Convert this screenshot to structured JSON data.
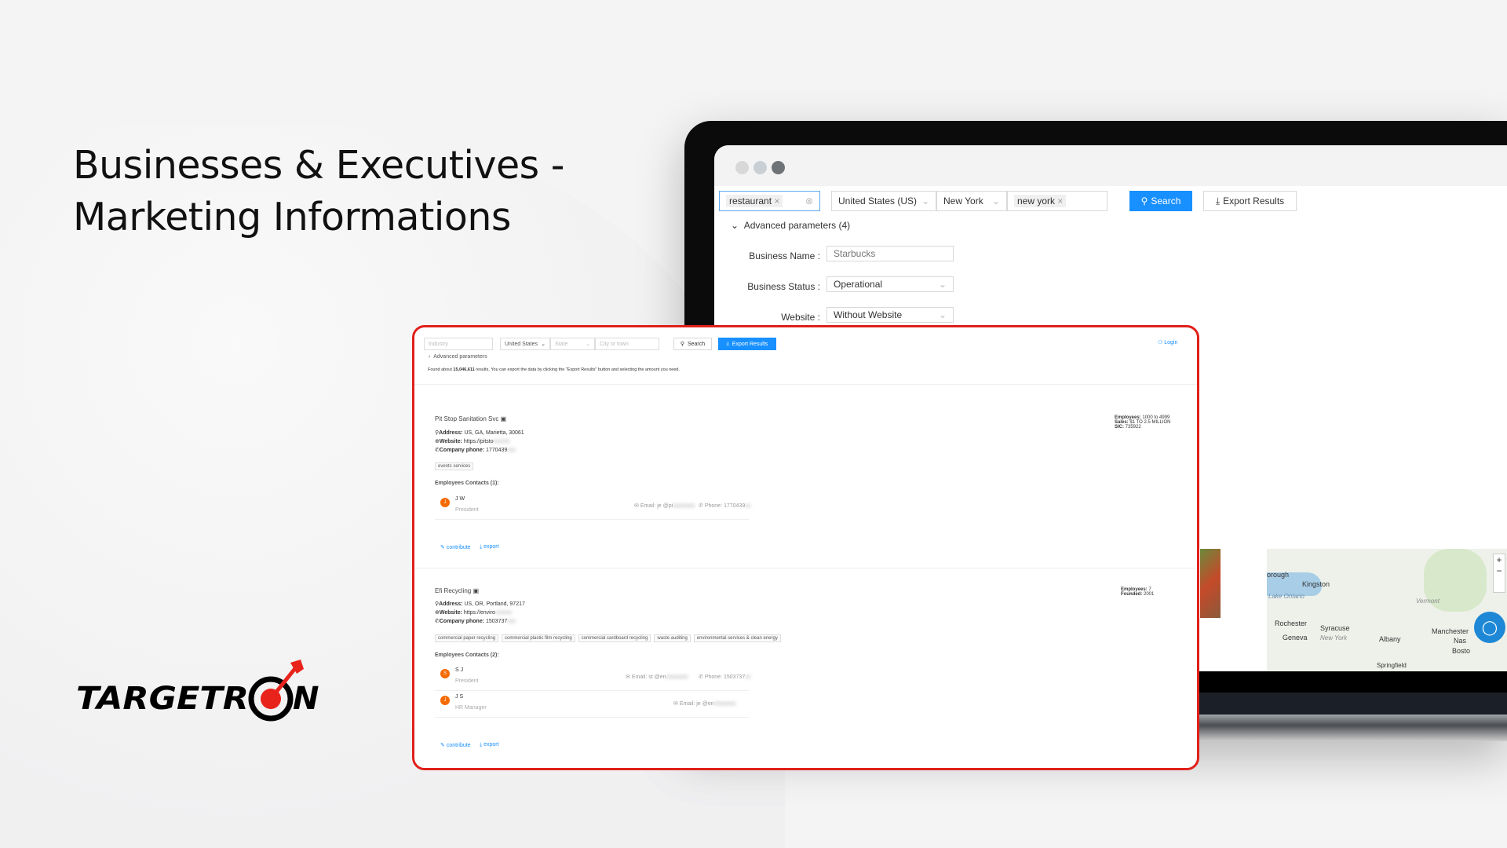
{
  "headline": {
    "line1": "Businesses & Executives -",
    "line2": "Marketing Informations"
  },
  "brand": {
    "logo_text": "TARGETRON",
    "accent": "#e8231c"
  },
  "laptop_app": {
    "keyword_tag": "restaurant",
    "country": "United States (US)",
    "state": "New York",
    "city_tag": "new york",
    "search_label": "Search",
    "export_label": "Export Results",
    "advanced_label": "Advanced parameters (4)",
    "fields": [
      {
        "label": "Business Name :",
        "placeholder": "Starbucks"
      },
      {
        "label": "Business Status :",
        "value": "Operational"
      },
      {
        "label": "Website :",
        "value": "Without Website"
      }
    ],
    "map_labels": [
      "orough",
      "Kingston",
      "Lake Ontario",
      "Vermont",
      "Rochester",
      "Syracuse",
      "Geneva",
      "New York",
      "Albany",
      "Manchester",
      "Nas",
      "Bosto",
      "Springfield"
    ]
  },
  "card": {
    "industry_placeholder": "Industry",
    "country": "United States",
    "state_placeholder": "State",
    "city_placeholder": "City or town",
    "search_label": "Search",
    "export_label": "Export Results",
    "login_label": "Login",
    "advanced_label": "Advanced parameters",
    "found_prefix": "Found about ",
    "found_count": "15,046,611",
    "found_suffix": " results. You can export the data by clicking the \"Export Results\" button and selecting the amount you need.",
    "labels": {
      "address": "Address:",
      "website": "Website:",
      "phone": "Company phone:",
      "email": "Email:",
      "cphone": "Phone:",
      "contribute": "contribute",
      "export": "export",
      "employees": "Employees:",
      "sales": "Sales:",
      "sic": "SIC:",
      "founded": "Founded:"
    },
    "companies": [
      {
        "name": "Pit Stop Sanitation Svc",
        "address": "US, GA, Marietta, 30061",
        "website": "https://pitsto",
        "phone": "1770439",
        "tags": [
          "events services"
        ],
        "contacts_label": "Employees Contacts (1):",
        "contacts": [
          {
            "initial": "J",
            "name": "J   W",
            "title": "President",
            "email": "je   @pi",
            "phone": "1770439"
          }
        ],
        "employees": "1000 to 4999",
        "sales": "$1 TO 2.5 MILLION",
        "sic": "735922"
      },
      {
        "name": "Efi Recycling",
        "address": "US, OR, Portland, 97217",
        "website": "https://enviro",
        "phone": "1503737",
        "tags": [
          "commercial paper recycling",
          "commercial plastic film recycling",
          "commercial cardboard recycling",
          "waste auditing",
          "environmental services & clean energy"
        ],
        "contacts_label": "Employees Contacts (2):",
        "contacts": [
          {
            "initial": "S",
            "name": "S   J",
            "title": "President",
            "email": "st   @en",
            "phone": "1503737"
          },
          {
            "initial": "J",
            "name": "J   S",
            "title": "HR Manager",
            "email": "je   @en"
          }
        ],
        "employees": "7",
        "founded": "2001"
      }
    ]
  }
}
